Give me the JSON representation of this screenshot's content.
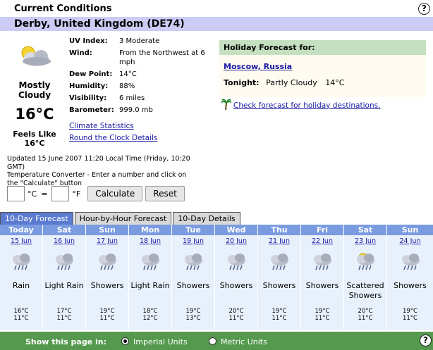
{
  "header": {
    "title": "Current Conditions",
    "location": "Derby, United Kingdom (DE74)"
  },
  "current": {
    "condition": "Mostly Cloudy",
    "temp": "16°C",
    "feels_label": "Feels Like",
    "feels_value": "16°C",
    "icon": "mostly-cloudy-icon",
    "details": [
      {
        "label": "UV Index:",
        "value": "3 Moderate"
      },
      {
        "label": "Wind:",
        "value": "From the Northwest at 6 mph"
      },
      {
        "label": "Dew Point:",
        "value": "14°C"
      },
      {
        "label": "Humidity:",
        "value": "88%"
      },
      {
        "label": "Visibility:",
        "value": "6 miles"
      },
      {
        "label": "Barometer:",
        "value": "999.0 mb"
      }
    ],
    "links": {
      "climate": "Climate Statistics",
      "round_clock": "Round the Clock Details"
    },
    "updated": "Updated 15 June 2007 11:20 Local Time (Friday, 10:20 GMT)",
    "converter_note": "Temperature Converter - Enter a number and click on the \"Calculate\" button"
  },
  "converter": {
    "c_unit": "°C",
    "equals": "=",
    "f_unit": "°F",
    "calculate": "Calculate",
    "reset": "Reset"
  },
  "holiday": {
    "header": "Holiday Forecast for:",
    "city": "Moscow, Russia",
    "tonight_label": "Tonight:",
    "tonight_cond": "Partly Cloudy",
    "tonight_temp": "14°C",
    "check_link": "Check forecast for holiday destinations.",
    "check_icon": "palm-tree-icon"
  },
  "tabs": [
    {
      "label": "10-Day Forecast",
      "active": true
    },
    {
      "label": "Hour-by-Hour Forecast",
      "active": false
    },
    {
      "label": "10-Day Details",
      "active": false
    }
  ],
  "forecast": [
    {
      "day": "Today",
      "date": "15 Jun",
      "cond": "Rain",
      "high": "16°C",
      "low": "11°C",
      "icon": "rain-cloud-icon"
    },
    {
      "day": "Sat",
      "date": "16 Jun",
      "cond": "Light Rain",
      "high": "17°C",
      "low": "11°C",
      "icon": "rain-cloud-icon"
    },
    {
      "day": "Sun",
      "date": "17 Jun",
      "cond": "Showers",
      "high": "19°C",
      "low": "11°C",
      "icon": "rain-cloud-icon"
    },
    {
      "day": "Mon",
      "date": "18 Jun",
      "cond": "Light Rain",
      "high": "18°C",
      "low": "12°C",
      "icon": "rain-cloud-icon"
    },
    {
      "day": "Tue",
      "date": "19 Jun",
      "cond": "Showers",
      "high": "19°C",
      "low": "13°C",
      "icon": "rain-cloud-icon"
    },
    {
      "day": "Wed",
      "date": "20 Jun",
      "cond": "Showers",
      "high": "20°C",
      "low": "11°C",
      "icon": "rain-cloud-icon"
    },
    {
      "day": "Thu",
      "date": "21 Jun",
      "cond": "Showers",
      "high": "19°C",
      "low": "11°C",
      "icon": "rain-cloud-icon"
    },
    {
      "day": "Fri",
      "date": "22 Jun",
      "cond": "Showers",
      "high": "19°C",
      "low": "11°C",
      "icon": "rain-cloud-icon"
    },
    {
      "day": "Sat",
      "date": "23 Jun",
      "cond": "Scattered Showers",
      "high": "20°C",
      "low": "11°C",
      "icon": "sun-rain-cloud-icon"
    },
    {
      "day": "Sun",
      "date": "24 Jun",
      "cond": "Showers",
      "high": "19°C",
      "low": "11°C",
      "icon": "rain-cloud-icon"
    }
  ],
  "footer": {
    "label": "Show this page in:",
    "imperial": "Imperial Units",
    "metric": "Metric Units",
    "selected": "imperial"
  },
  "help_glyph": "?"
}
